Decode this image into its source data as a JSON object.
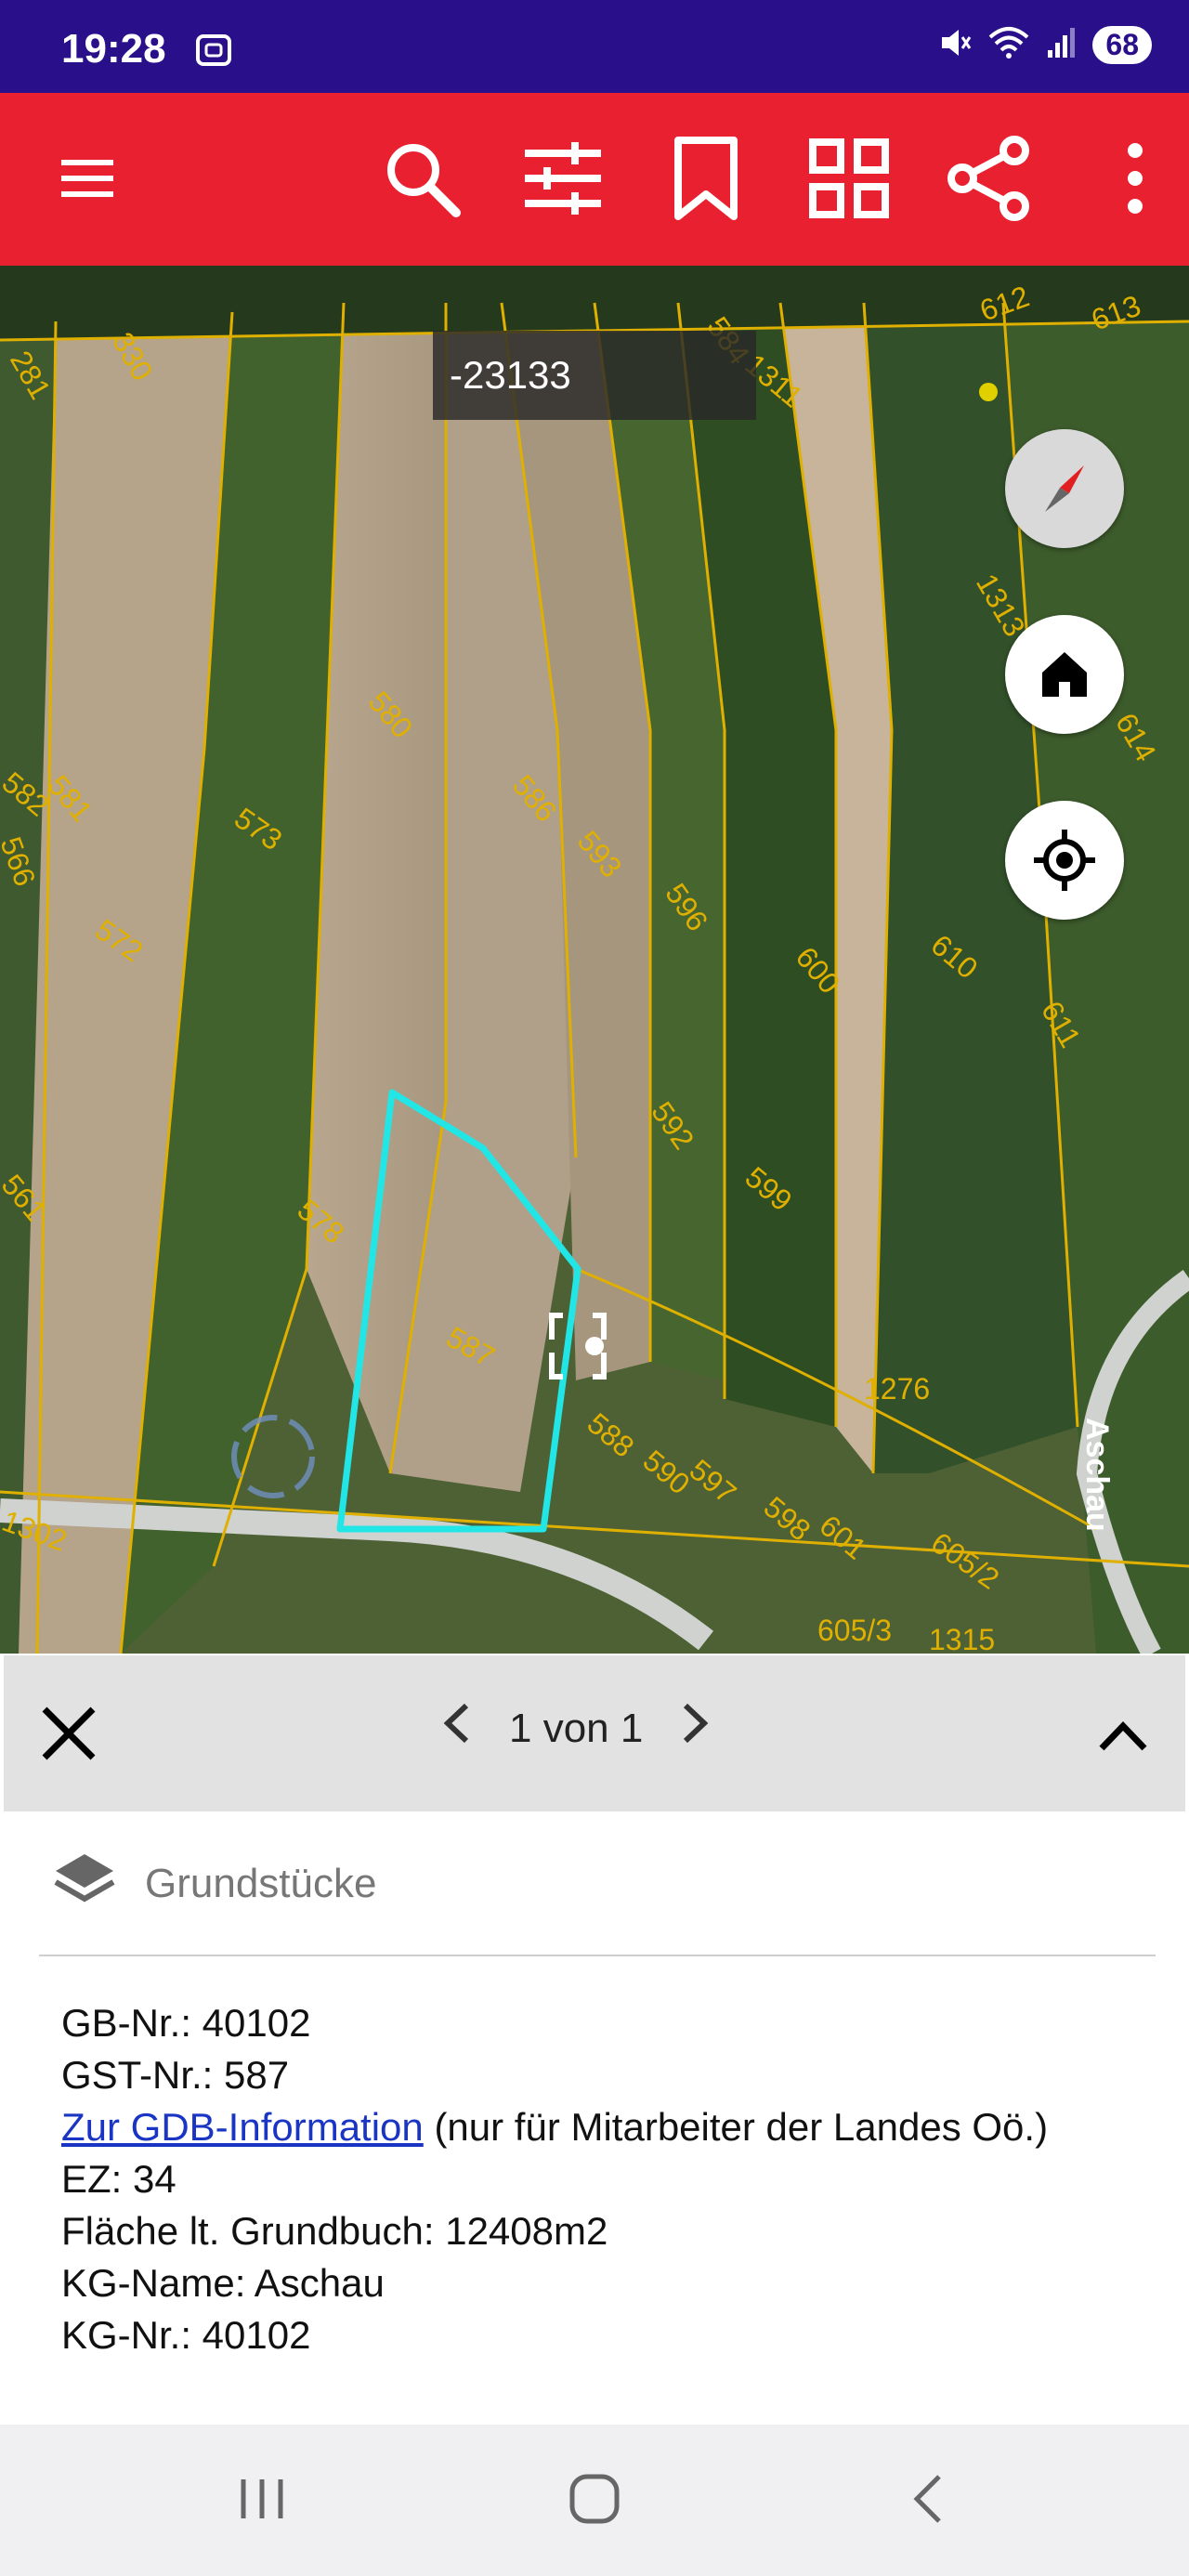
{
  "status_bar": {
    "time": "19:28",
    "battery": "68"
  },
  "toolbar": {
    "icons": [
      "menu-icon",
      "search-icon",
      "filter-icon",
      "bookmark-icon",
      "grid-icon",
      "share-icon",
      "more-vertical-icon"
    ],
    "background": "#e8202f"
  },
  "map": {
    "coordinate_readout": "-23133",
    "selection_color": "#22e6e6",
    "parcel_line_color": "#e0b000",
    "parcel_labels": [
      "281",
      "330",
      "573",
      "572",
      "580",
      "586",
      "593",
      "596",
      "600",
      "610",
      "611",
      "614",
      "1313",
      "584",
      "1311",
      "612",
      "613",
      "578",
      "587",
      "588",
      "590",
      "597",
      "598",
      "601",
      "605/2",
      "592",
      "599",
      "582",
      "581",
      "566",
      "561",
      "1276",
      "1302",
      "605/3",
      "1315"
    ],
    "street_label": "Aschau"
  },
  "panel": {
    "pager_text": "1 von 1",
    "layer_label": "Grundstücke",
    "gb_nr": "GB-Nr.: 40102",
    "gst_nr": "GST-Nr.: 587",
    "link_text": "Zur GDB-Information",
    "link_note": " (nur für Mitarbeiter der Landes Oö.)",
    "ez": "EZ: 34",
    "flaeche": "Fläche lt. Grundbuch: 12408m2",
    "kg_name": "KG-Name: Aschau",
    "kg_nr": "KG-Nr.: 40102"
  }
}
